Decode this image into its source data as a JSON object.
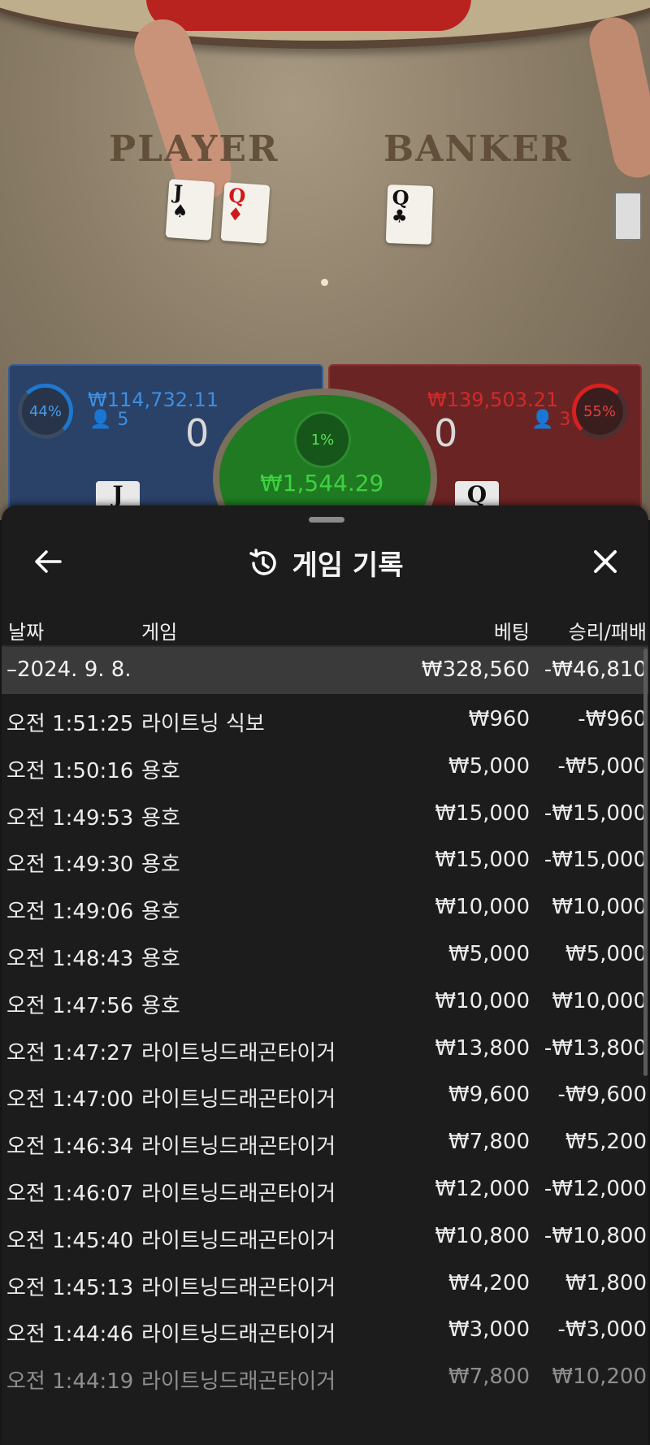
{
  "game_view": {
    "player_label": "PLAYER",
    "banker_label": "BANKER",
    "cards": {
      "player": [
        {
          "rank": "J",
          "suit": "♠"
        },
        {
          "rank": "Q",
          "suit": "♦"
        }
      ],
      "banker": [
        {
          "rank": "Q",
          "suit": "♣"
        }
      ]
    },
    "player_panel": {
      "percent": "44%",
      "amount": "₩114,732.11",
      "players": "5",
      "score": "0",
      "card": "J"
    },
    "banker_panel": {
      "percent": "55%",
      "amount": "₩139,503.21",
      "players": "3",
      "score": "0",
      "card": "Q"
    },
    "tie_panel": {
      "percent": "1%",
      "amount": "₩1,544.29"
    }
  },
  "sheet": {
    "title": "게임 기록",
    "icons": {
      "back": "arrow-left-icon",
      "history": "history-icon",
      "close": "close-icon"
    },
    "columns": {
      "date": "날짜",
      "game": "게임",
      "bet": "베팅",
      "result": "승리/패배"
    },
    "group": {
      "date": "–2024. 9. 8.",
      "bet": "₩328,560",
      "result": "-₩46,810"
    },
    "rows": [
      {
        "time": "오전 1:51:25",
        "game": "라이트닝 식보",
        "bet": "₩960",
        "result": "-₩960"
      },
      {
        "time": "오전 1:50:16",
        "game": "용호",
        "bet": "₩5,000",
        "result": "-₩5,000"
      },
      {
        "time": "오전 1:49:53",
        "game": "용호",
        "bet": "₩15,000",
        "result": "-₩15,000"
      },
      {
        "time": "오전 1:49:30",
        "game": "용호",
        "bet": "₩15,000",
        "result": "-₩15,000"
      },
      {
        "time": "오전 1:49:06",
        "game": "용호",
        "bet": "₩10,000",
        "result": "₩10,000"
      },
      {
        "time": "오전 1:48:43",
        "game": "용호",
        "bet": "₩5,000",
        "result": "₩5,000"
      },
      {
        "time": "오전 1:47:56",
        "game": "용호",
        "bet": "₩10,000",
        "result": "₩10,000"
      },
      {
        "time": "오전 1:47:27",
        "game": "라이트닝드래곤타이거",
        "bet": "₩13,800",
        "result": "-₩13,800"
      },
      {
        "time": "오전 1:47:00",
        "game": "라이트닝드래곤타이거",
        "bet": "₩9,600",
        "result": "-₩9,600"
      },
      {
        "time": "오전 1:46:34",
        "game": "라이트닝드래곤타이거",
        "bet": "₩7,800",
        "result": "₩5,200"
      },
      {
        "time": "오전 1:46:07",
        "game": "라이트닝드래곤타이거",
        "bet": "₩12,000",
        "result": "-₩12,000"
      },
      {
        "time": "오전 1:45:40",
        "game": "라이트닝드래곤타이거",
        "bet": "₩10,800",
        "result": "-₩10,800"
      },
      {
        "time": "오전 1:45:13",
        "game": "라이트닝드래곤타이거",
        "bet": "₩4,200",
        "result": "₩1,800"
      },
      {
        "time": "오전 1:44:46",
        "game": "라이트닝드래곤타이거",
        "bet": "₩3,000",
        "result": "-₩3,000"
      },
      {
        "time": "오전 1:44:19",
        "game": "라이트닝드래곤타이거",
        "bet": "₩7,800",
        "result": "₩10,200"
      }
    ]
  }
}
